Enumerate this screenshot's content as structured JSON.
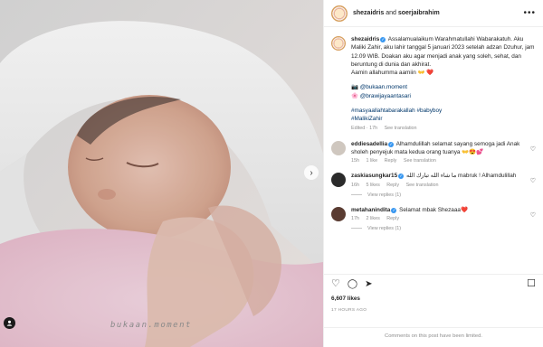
{
  "header": {
    "username": "shezaidris",
    "conjunction": "and",
    "collaborator": "soerjaibrahim",
    "more_label": "•••"
  },
  "caption": {
    "username": "shezaidris",
    "text": "Assalamualaikum Warahmatullahi Wabarakatuh. Aku Maliki Zahir, aku lahir tanggal 5 januari 2023 setelah adzan Dzuhur, jam 12.09 WIB. Doakan aku agar menjadi anak yang soleh, sehat, dan beruntung di dunia dan akhirat.",
    "line2": "Aamin allahumma aamiin 👐 ❤️",
    "credit1_icon": "📷",
    "credit1": "@bukaan.moment",
    "credit2_icon": "🌸",
    "credit2": "@brawijayaantasari",
    "hashtags": "#masyaallahtabarakallah #babyboy",
    "hashtag2": "#MalikiZahir",
    "edited": "Edited · 17h",
    "see_translation": "See translation"
  },
  "comments": [
    {
      "username": "eddiesadellia",
      "text": "Alhamdulillah selamat sayang semoga jadi Anak sholeh penyejuk mata kedua orang tuanya 👐😍💕",
      "time": "15h",
      "likes": "1 like",
      "reply": "Reply",
      "see_translation": "See translation",
      "heart": "♡"
    },
    {
      "username": "zaskiasungkar15",
      "text": "ما شاء الله تبارك الله mabruk ! Alhamdulillah",
      "time": "16h",
      "likes": "5 likes",
      "reply": "Reply",
      "see_translation": "See translation",
      "heart": "♡",
      "view_replies": "View replies (1)"
    },
    {
      "username": "metahanindita",
      "text": "Selamat mbak Shezaaa❤️",
      "time": "17h",
      "likes": "2 likes",
      "reply": "Reply",
      "heart": "♡",
      "view_replies": "View replies (1)"
    }
  ],
  "actions": {
    "like_icon": "♡",
    "comment_icon": "◯",
    "share_icon": "➤",
    "save_icon": "☐"
  },
  "likes": "6,607 likes",
  "time_ago": "17 HOURS AGO",
  "comments_limited": "Comments on this post have been limited.",
  "photo": {
    "watermark": "bukaan.moment",
    "next_icon": "›"
  },
  "colors": {
    "link": "#00376b",
    "verified": "#3897f0",
    "muted": "#8e8e8e"
  }
}
